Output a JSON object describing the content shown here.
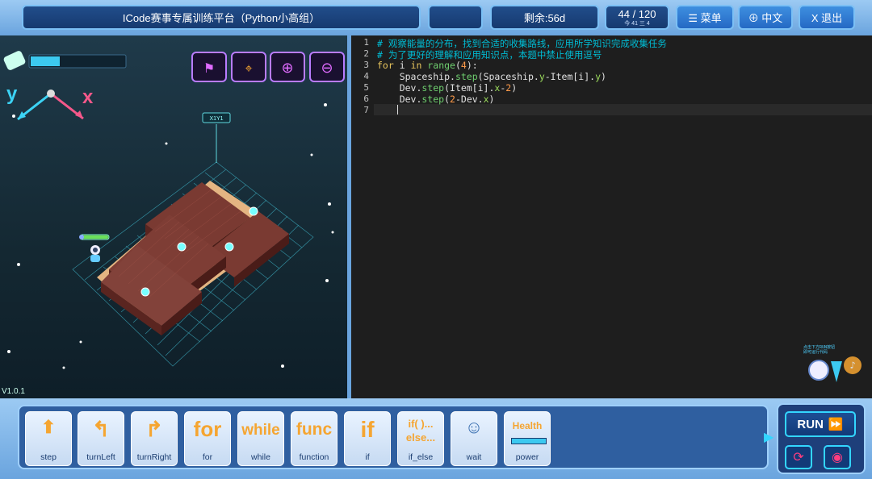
{
  "topbar": {
    "title": "ICode赛事专属训练平台（Python小高组）",
    "remaining": "剩余:56d",
    "counter": "44 / 120",
    "counter_sub": "今 41    三 4",
    "menu_label": "☰ 菜单",
    "lang_label": "⊕ 中文",
    "exit_label": "X 退出"
  },
  "game": {
    "version": "V1.0.1",
    "axis_x": "x",
    "axis_y": "y",
    "marker_label": "X1Y1",
    "tooltip": "点击下方RUN按钮\n即可运行代码"
  },
  "editor": {
    "lines": [
      "1",
      "2",
      "3",
      "4",
      "5",
      "6",
      "7"
    ],
    "code": {
      "l1": "# 观察能量的分布，找到合适的收集路线，应用所学知识完成收集任务",
      "l2": "# 为了更好的理解和应用知识点，本题中禁止使用逗号",
      "l3_kw1": "for",
      "l3_a": " i ",
      "l3_kw2": "in",
      "l3_b": " ",
      "l3_fn": "range",
      "l3_c": "(",
      "l3_num": "4",
      "l3_d": "):",
      "l4_a": "    Spaceship.",
      "l4_fn": "step",
      "l4_b": "(Spaceship.",
      "l4_attr": "y",
      "l4_c": "-Item[i].",
      "l4_attr2": "y",
      "l4_d": ")",
      "l5_a": "    Dev.",
      "l5_fn": "step",
      "l5_b": "(Item[i].",
      "l5_attr": "x",
      "l5_c": "-",
      "l5_num": "2",
      "l5_d": ")",
      "l6_a": "    Dev.",
      "l6_fn": "step",
      "l6_b": "(",
      "l6_num": "2",
      "l6_c": "-Dev.",
      "l6_attr": "x",
      "l6_d": ")"
    }
  },
  "blocks": [
    {
      "label": "step",
      "icon": "step-icon"
    },
    {
      "label": "turnLeft",
      "icon": "turn-left-icon"
    },
    {
      "label": "turnRight",
      "icon": "turn-right-icon"
    },
    {
      "label": "for",
      "icon_text": "for"
    },
    {
      "label": "while",
      "icon_text": "while"
    },
    {
      "label": "function",
      "icon_text": "func"
    },
    {
      "label": "if",
      "icon_text": "if"
    },
    {
      "label": "if_else",
      "icon_text": "if( )...\nelse..."
    },
    {
      "label": "wait",
      "icon": "robot-icon"
    },
    {
      "label": "power",
      "icon_text": "Health"
    }
  ],
  "run": {
    "label": "RUN"
  },
  "colors": {
    "accent": "#33d6ff",
    "block_text": "#f5a531",
    "frame": "#7cc0f5"
  }
}
